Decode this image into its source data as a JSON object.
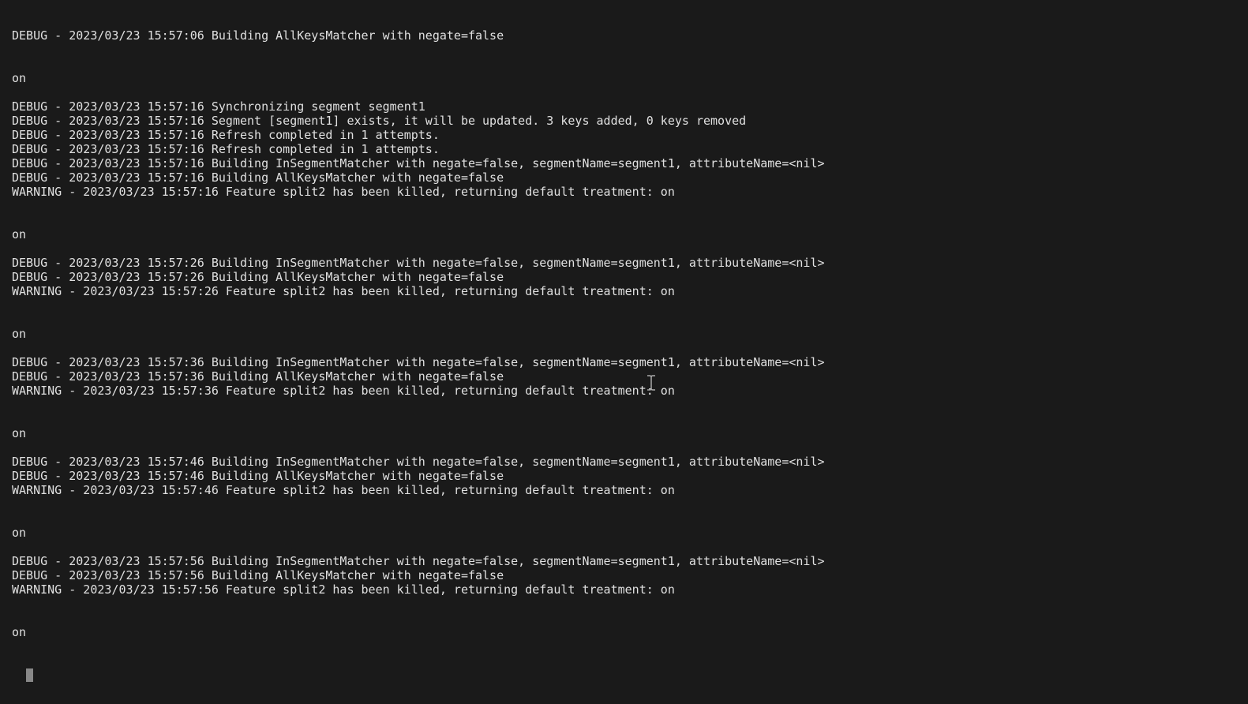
{
  "terminal": {
    "lines": [
      {
        "type": "log",
        "text": "DEBUG - 2023/03/23 15:57:06 Building AllKeysMatcher with negate=false"
      },
      {
        "type": "blank"
      },
      {
        "type": "blank"
      },
      {
        "type": "log",
        "text": "on"
      },
      {
        "type": "blank"
      },
      {
        "type": "log",
        "text": "DEBUG - 2023/03/23 15:57:16 Synchronizing segment segment1"
      },
      {
        "type": "log",
        "text": "DEBUG - 2023/03/23 15:57:16 Segment [segment1] exists, it will be updated. 3 keys added, 0 keys removed"
      },
      {
        "type": "log",
        "text": "DEBUG - 2023/03/23 15:57:16 Refresh completed in 1 attempts."
      },
      {
        "type": "log",
        "text": "DEBUG - 2023/03/23 15:57:16 Refresh completed in 1 attempts."
      },
      {
        "type": "log",
        "text": "DEBUG - 2023/03/23 15:57:16 Building InSegmentMatcher with negate=false, segmentName=segment1, attributeName=<nil>"
      },
      {
        "type": "log",
        "text": "DEBUG - 2023/03/23 15:57:16 Building AllKeysMatcher with negate=false"
      },
      {
        "type": "log",
        "text": "WARNING - 2023/03/23 15:57:16 Feature split2 has been killed, returning default treatment: on"
      },
      {
        "type": "blank"
      },
      {
        "type": "blank"
      },
      {
        "type": "log",
        "text": "on"
      },
      {
        "type": "blank"
      },
      {
        "type": "log",
        "text": "DEBUG - 2023/03/23 15:57:26 Building InSegmentMatcher with negate=false, segmentName=segment1, attributeName=<nil>"
      },
      {
        "type": "log",
        "text": "DEBUG - 2023/03/23 15:57:26 Building AllKeysMatcher with negate=false"
      },
      {
        "type": "log",
        "text": "WARNING - 2023/03/23 15:57:26 Feature split2 has been killed, returning default treatment: on"
      },
      {
        "type": "blank"
      },
      {
        "type": "blank"
      },
      {
        "type": "log",
        "text": "on"
      },
      {
        "type": "blank"
      },
      {
        "type": "log",
        "text": "DEBUG - 2023/03/23 15:57:36 Building InSegmentMatcher with negate=false, segmentName=segment1, attributeName=<nil>"
      },
      {
        "type": "log",
        "text": "DEBUG - 2023/03/23 15:57:36 Building AllKeysMatcher with negate=false"
      },
      {
        "type": "log",
        "text": "WARNING - 2023/03/23 15:57:36 Feature split2 has been killed, returning default treatment: on"
      },
      {
        "type": "blank"
      },
      {
        "type": "blank"
      },
      {
        "type": "log",
        "text": "on"
      },
      {
        "type": "blank"
      },
      {
        "type": "log",
        "text": "DEBUG - 2023/03/23 15:57:46 Building InSegmentMatcher with negate=false, segmentName=segment1, attributeName=<nil>"
      },
      {
        "type": "log",
        "text": "DEBUG - 2023/03/23 15:57:46 Building AllKeysMatcher with negate=false"
      },
      {
        "type": "log",
        "text": "WARNING - 2023/03/23 15:57:46 Feature split2 has been killed, returning default treatment: on"
      },
      {
        "type": "blank"
      },
      {
        "type": "blank"
      },
      {
        "type": "log",
        "text": "on"
      },
      {
        "type": "blank"
      },
      {
        "type": "log",
        "text": "DEBUG - 2023/03/23 15:57:56 Building InSegmentMatcher with negate=false, segmentName=segment1, attributeName=<nil>"
      },
      {
        "type": "log",
        "text": "DEBUG - 2023/03/23 15:57:56 Building AllKeysMatcher with negate=false"
      },
      {
        "type": "log",
        "text": "WARNING - 2023/03/23 15:57:56 Feature split2 has been killed, returning default treatment: on"
      },
      {
        "type": "blank"
      },
      {
        "type": "blank"
      },
      {
        "type": "log",
        "text": "on"
      },
      {
        "type": "blank"
      }
    ]
  }
}
